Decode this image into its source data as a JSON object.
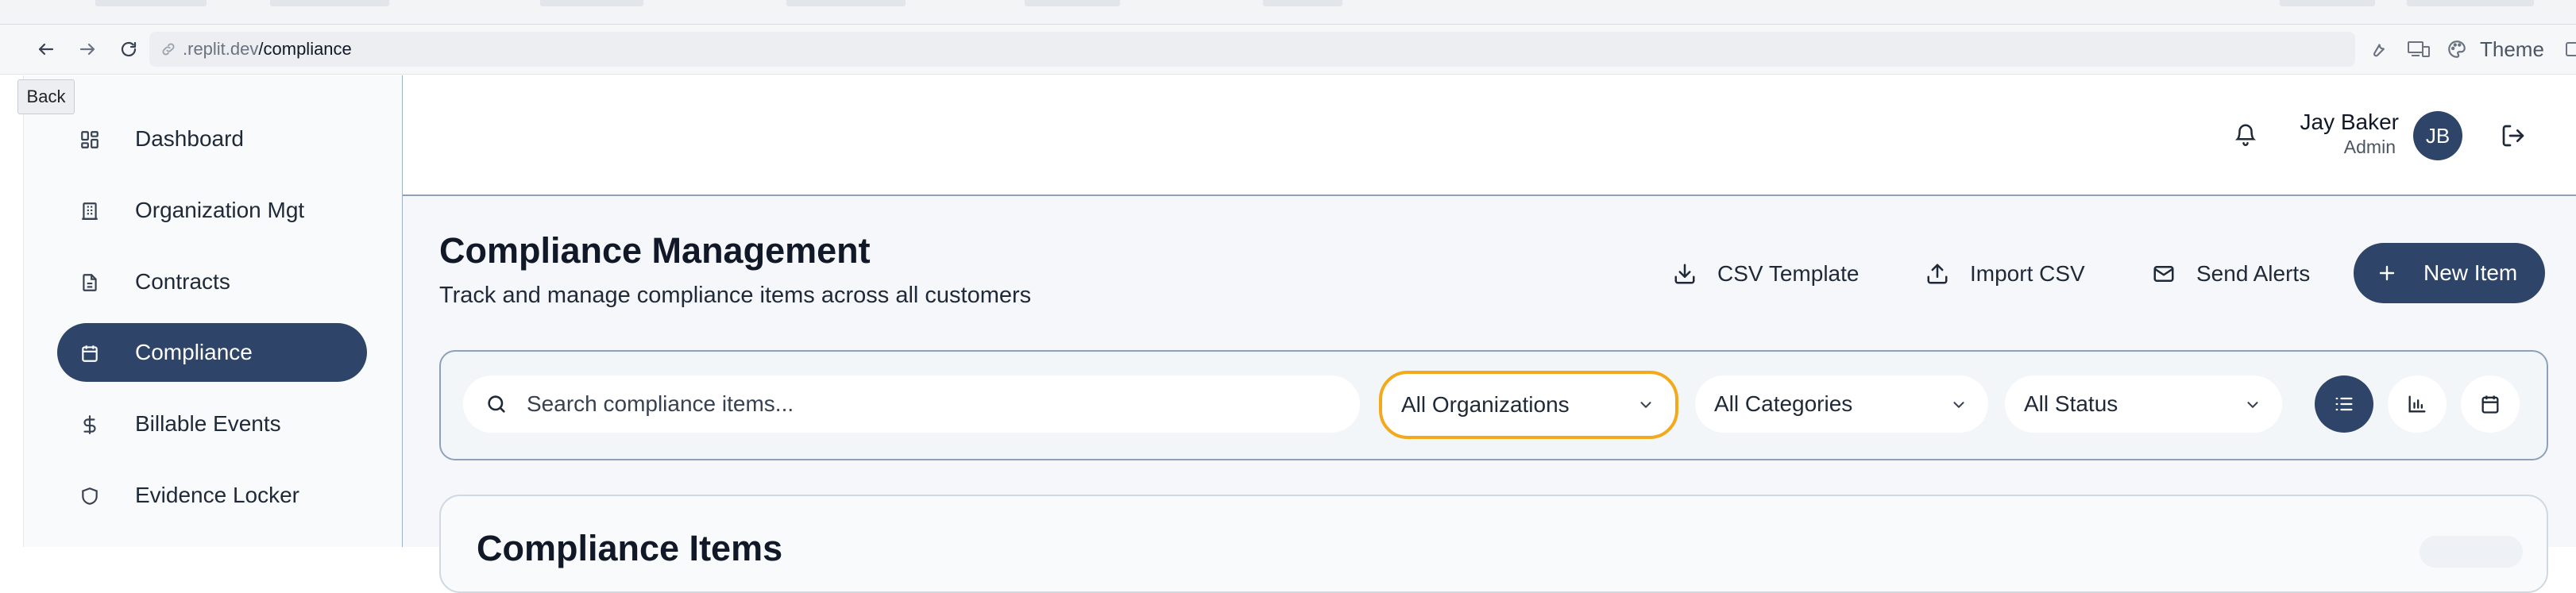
{
  "browser": {
    "url_host": ".replit.dev",
    "url_path": "/compliance",
    "theme_label": "Theme",
    "back_tooltip": "Back"
  },
  "sidebar": {
    "items": [
      {
        "label": "Dashboard",
        "icon": "dashboard-grid-icon",
        "active": false
      },
      {
        "label": "Organization Mgt",
        "icon": "building-icon",
        "active": false
      },
      {
        "label": "Contracts",
        "icon": "document-icon",
        "active": false
      },
      {
        "label": "Compliance",
        "icon": "calendar-icon",
        "active": true
      },
      {
        "label": "Billable Events",
        "icon": "dollar-icon",
        "active": false
      },
      {
        "label": "Evidence Locker",
        "icon": "shield-icon",
        "active": false
      }
    ]
  },
  "header": {
    "user_name": "Jay Baker",
    "user_role": "Admin",
    "avatar_initials": "JB"
  },
  "page": {
    "title": "Compliance Management",
    "subtitle": "Track and manage compliance items across all customers"
  },
  "actions": {
    "csv_template": "CSV Template",
    "import_csv": "Import CSV",
    "send_alerts": "Send Alerts",
    "new_item": "New Item"
  },
  "filters": {
    "search_placeholder": "Search compliance items...",
    "organization": "All Organizations",
    "category": "All Categories",
    "status": "All Status",
    "view_modes": [
      "list-view-icon",
      "chart-view-icon",
      "calendar-view-icon"
    ],
    "active_view": "list"
  },
  "card": {
    "title": "Compliance Items"
  },
  "colors": {
    "primary": "#2e4468",
    "focus_ring": "#f2a91c",
    "sidebar_bg": "#f8fafc"
  }
}
